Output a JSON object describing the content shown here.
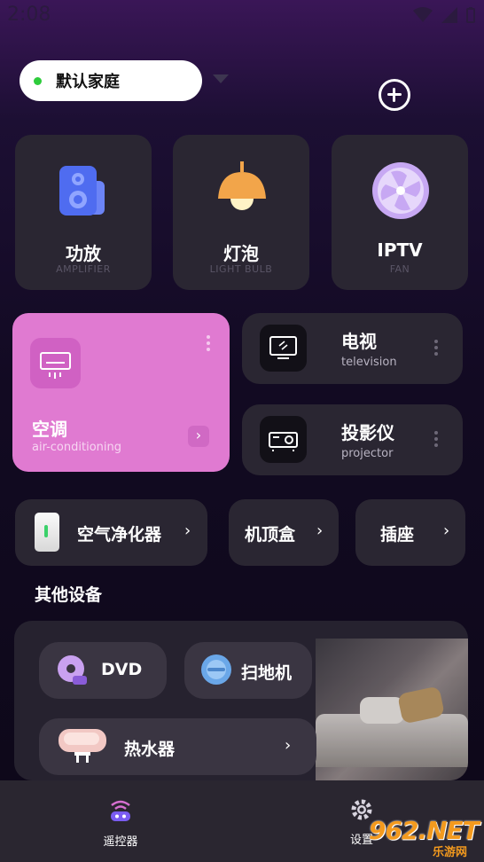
{
  "status": {
    "time": "2:08"
  },
  "header": {
    "home_label": "默认家庭"
  },
  "top_cards": [
    {
      "title": "功放",
      "subtitle": "AMPLIFIER",
      "icon": "speaker-icon"
    },
    {
      "title": "灯泡",
      "subtitle": "LIGHT BULB",
      "icon": "lamp-icon"
    },
    {
      "title": "IPTV",
      "subtitle": "FAN",
      "icon": "fan-icon"
    }
  ],
  "ac_card": {
    "title": "空调",
    "subtitle": "air-conditioning",
    "icon": "air-conditioner-icon",
    "accent": "#e07ad1"
  },
  "mid_cards": [
    {
      "title": "电视",
      "subtitle": "television",
      "icon": "tv-icon"
    },
    {
      "title": "投影仪",
      "subtitle": "projector",
      "icon": "projector-icon"
    }
  ],
  "small_cards": [
    {
      "title": "空气净化器",
      "icon": "air-purifier-icon"
    },
    {
      "title": "机顶盒"
    },
    {
      "title": "插座"
    }
  ],
  "other_section": {
    "title": "其他设备",
    "items": [
      {
        "title": "DVD",
        "icon": "dvd-icon"
      },
      {
        "title": "扫地机",
        "icon": "robot-vacuum-icon"
      },
      {
        "title": "热水器",
        "icon": "water-heater-icon"
      }
    ]
  },
  "bottom_nav": [
    {
      "label": "遥控器",
      "icon": "remote-icon",
      "active": true
    },
    {
      "label": "设置",
      "icon": "gear-icon",
      "active": false
    }
  ],
  "watermark": {
    "text": "962.NET",
    "sub": "乐游网"
  }
}
